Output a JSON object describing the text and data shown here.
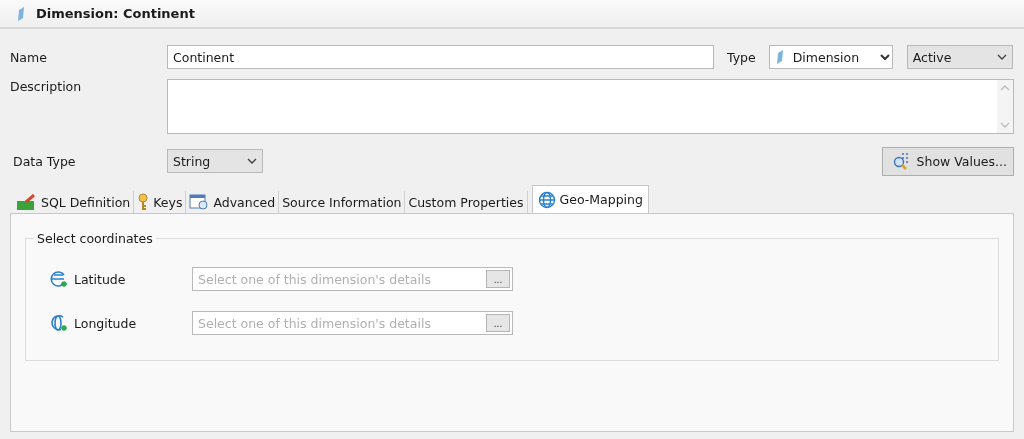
{
  "editor": {
    "title": "Dimension: Continent"
  },
  "form": {
    "name_label": "Name",
    "name_value": "Continent",
    "type_label": "Type",
    "type_value": "Dimension",
    "status_value": "Active",
    "description_label": "Description",
    "data_type_label": "Data Type",
    "data_type_value": "String",
    "show_values_button": "Show Values..."
  },
  "tabs": [
    {
      "label": "SQL Definition",
      "selected": false
    },
    {
      "label": "Keys",
      "selected": false
    },
    {
      "label": "Advanced",
      "selected": false
    },
    {
      "label": "Source Information",
      "selected": false
    },
    {
      "label": "Custom Properties",
      "selected": false
    },
    {
      "label": "Geo-Mapping",
      "selected": true
    }
  ],
  "geo_mapping": {
    "group_title": "Select coordinates",
    "rows": [
      {
        "label": "Latitude",
        "placeholder": "Select one of this dimension's details",
        "button": "..."
      },
      {
        "label": "Longitude",
        "placeholder": "Select one of this dimension's details",
        "button": "..."
      }
    ]
  }
}
